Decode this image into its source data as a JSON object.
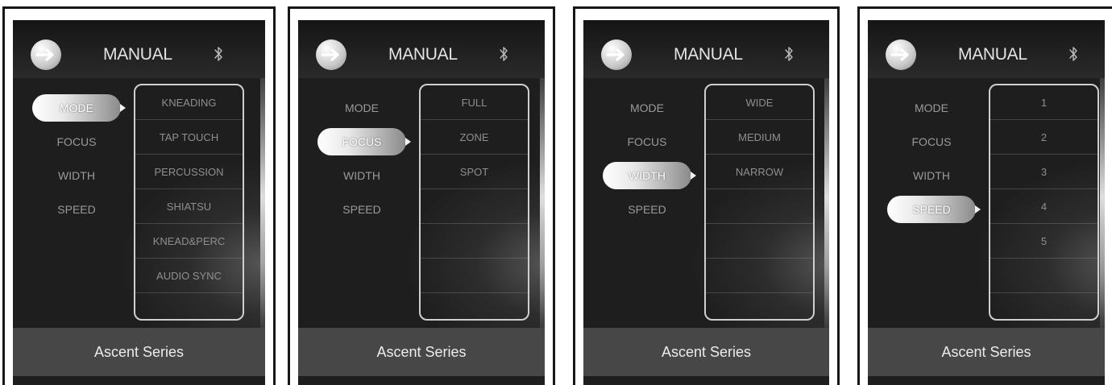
{
  "panels": [
    {
      "title": "MANUAL",
      "menu": [
        "MODE",
        "FOCUS",
        "WIDTH",
        "SPEED"
      ],
      "selected_index": 0,
      "options": [
        "KNEADING",
        "TAP TOUCH",
        "PERCUSSION",
        "SHIATSU",
        "KNEAD&PERC",
        "AUDIO SYNC"
      ],
      "footer": "Ascent Series"
    },
    {
      "title": "MANUAL",
      "menu": [
        "MODE",
        "FOCUS",
        "WIDTH",
        "SPEED"
      ],
      "selected_index": 1,
      "options": [
        "FULL",
        "ZONE",
        "SPOT"
      ],
      "footer": "Ascent Series"
    },
    {
      "title": "MANUAL",
      "menu": [
        "MODE",
        "FOCUS",
        "WIDTH",
        "SPEED"
      ],
      "selected_index": 2,
      "options": [
        "WIDE",
        "MEDIUM",
        "NARROW"
      ],
      "footer": "Ascent Series"
    },
    {
      "title": "MANUAL",
      "menu": [
        "MODE",
        "FOCUS",
        "WIDTH",
        "SPEED"
      ],
      "selected_index": 3,
      "options": [
        "1",
        "2",
        "3",
        "4",
        "5"
      ],
      "footer": "Ascent Series"
    }
  ],
  "icons": {
    "back": "arrow-right-circle-icon",
    "connectivity": "bluetooth-icon"
  },
  "colors": {
    "screen_bg": "#1e1e1e",
    "footer_bg": "#474747",
    "text_active": "#ffffff",
    "text_inactive": "#9a9a9a"
  }
}
